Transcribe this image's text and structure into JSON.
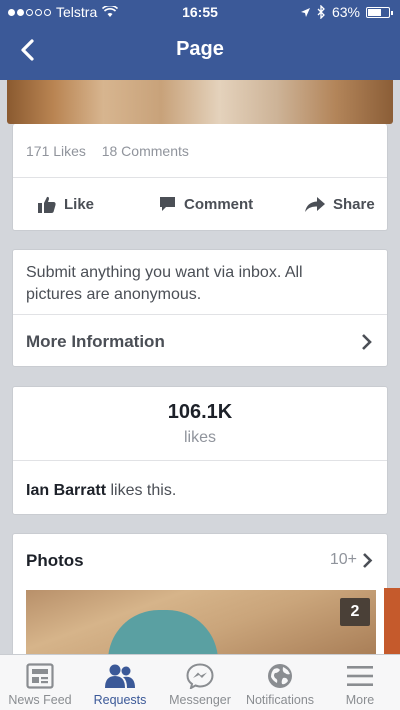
{
  "status_bar": {
    "carrier": "Telstra",
    "time": "16:55",
    "battery": "63%",
    "battery_level": 0.63
  },
  "nav": {
    "title": "Page"
  },
  "post": {
    "likes": "171 Likes",
    "comments": "18 Comments",
    "actions": {
      "like": "Like",
      "comment": "Comment",
      "share": "Share"
    }
  },
  "about": {
    "description": "Submit anything you want via inbox. All pictures are anonymous.",
    "more_info": "More Information"
  },
  "stats": {
    "count": "106.1K",
    "unit": "likes",
    "friend_name": "Ian Barratt",
    "friend_suffix": " likes this."
  },
  "photos": {
    "title": "Photos",
    "count": "10+",
    "badge": "2"
  },
  "tabs": [
    {
      "label": "News Feed",
      "icon": "news-feed-icon"
    },
    {
      "label": "Requests",
      "icon": "friend-requests-icon"
    },
    {
      "label": "Messenger",
      "icon": "messenger-icon"
    },
    {
      "label": "Notifications",
      "icon": "globe-icon"
    },
    {
      "label": "More",
      "icon": "menu-icon"
    }
  ],
  "active_tab": "Requests",
  "colors": {
    "brand": "#3b5998",
    "background": "#d3d6db"
  }
}
